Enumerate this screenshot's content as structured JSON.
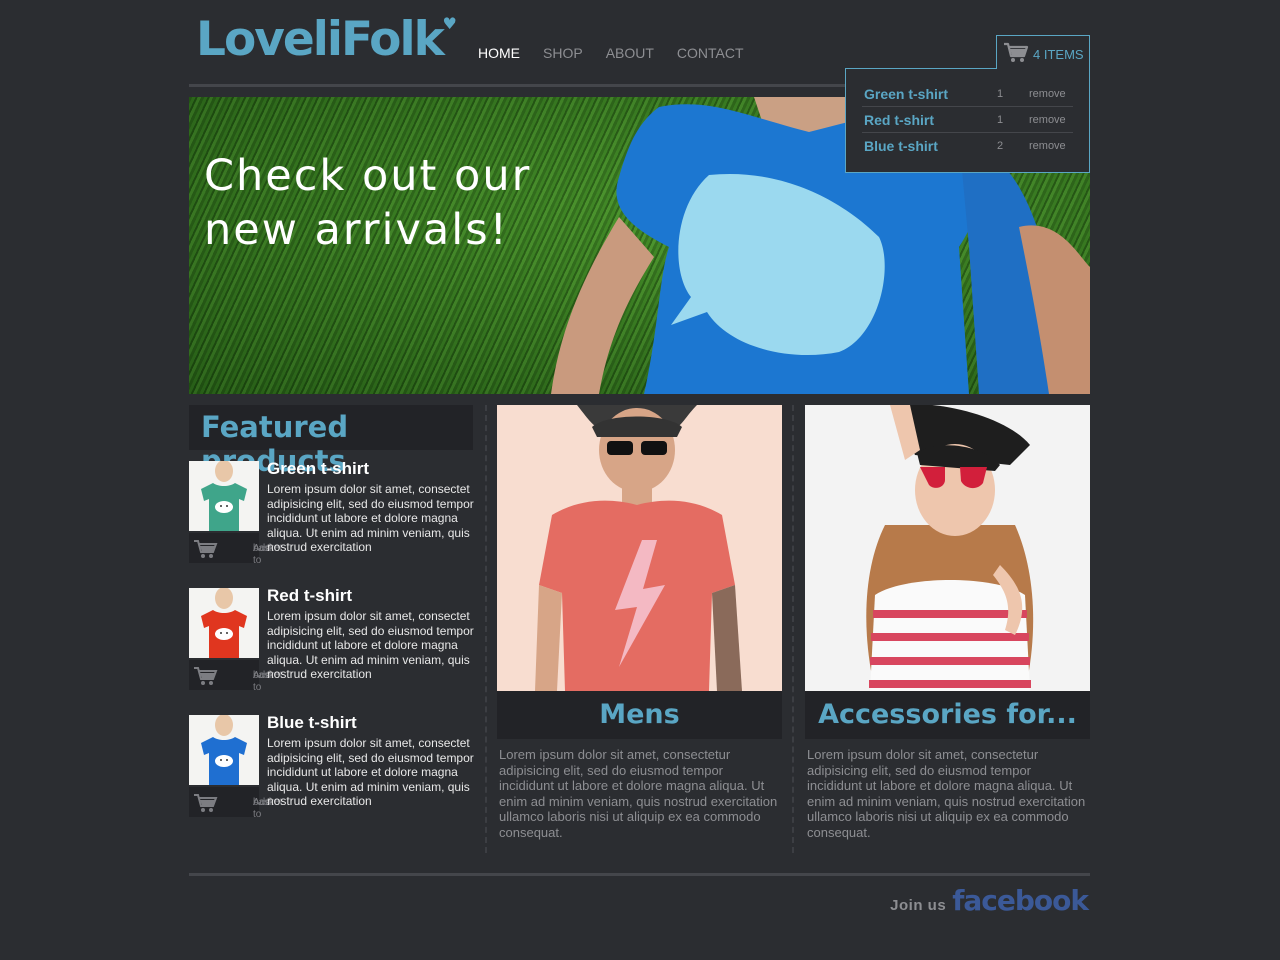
{
  "brand": {
    "name": "LoveliFolk",
    "heart": "♥",
    "accent": "#5aa6c4"
  },
  "nav": {
    "items": [
      "HOME",
      "SHOP",
      "ABOUT",
      "CONTACT"
    ],
    "active": "HOME"
  },
  "cart": {
    "count_label": "4 ITEMS",
    "items": [
      {
        "name": "Green t-shirt",
        "qty": "1",
        "remove": "remove"
      },
      {
        "name": "Red t-shirt",
        "qty": "1",
        "remove": "remove"
      },
      {
        "name": "Blue t-shirt",
        "qty": "2",
        "remove": "remove"
      }
    ]
  },
  "hero": {
    "title": "Check out our new arrivals!"
  },
  "featured": {
    "heading": "Featured products",
    "add_label_1": "Add to",
    "add_label_2": "basket",
    "products": [
      {
        "name": "Green t-shirt",
        "color": "#3fa58a",
        "desc": "Lorem ipsum dolor sit amet, consectet adipisicing elit, sed do eiusmod tempor incididunt ut labore et dolore magna aliqua. Ut enim ad minim veniam, quis nostrud exercitation"
      },
      {
        "name": "Red t-shirt",
        "color": "#e0361f",
        "desc": "Lorem ipsum dolor sit amet, consectet adipisicing elit, sed do eiusmod tempor incididunt ut labore et dolore magna aliqua. Ut enim ad minim veniam, quis nostrud exercitation"
      },
      {
        "name": "Blue t-shirt",
        "color": "#1f6fd1",
        "desc": "Lorem ipsum dolor sit amet, consectet adipisicing elit, sed do eiusmod tempor incididunt ut labore et dolore magna aliqua. Ut enim ad minim veniam, quis nostrud exercitation"
      }
    ]
  },
  "categories": [
    {
      "label": "Mens",
      "desc": "Lorem ipsum dolor sit amet, consectetur adipisicing elit, sed do eiusmod tempor incididunt ut labore et dolore magna aliqua. Ut enim ad minim veniam, quis nostrud exercitation ullamco laboris nisi ut aliquip ex ea commodo consequat."
    },
    {
      "label": "Accessories for...",
      "desc": "Lorem ipsum dolor sit amet, consectetur adipisicing elit, sed do eiusmod tempor incididunt ut labore et dolore magna aliqua. Ut enim ad minim veniam, quis nostrud exercitation ullamco laboris nisi ut aliquip ex ea commodo consequat."
    }
  ],
  "footer": {
    "join": "Join us",
    "social": "facebook",
    "social_color": "#3b5998"
  }
}
